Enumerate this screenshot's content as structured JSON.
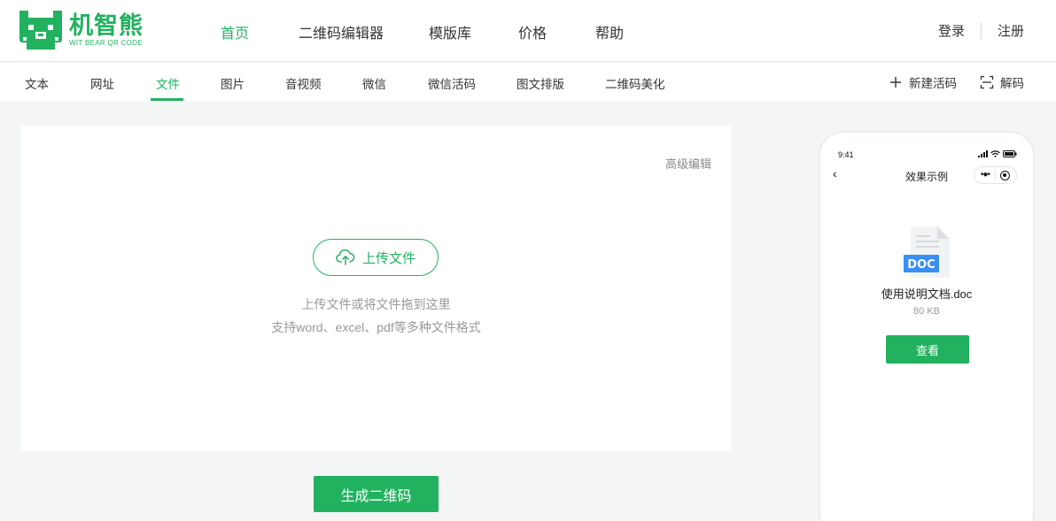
{
  "brand": {
    "name_cn": "机智熊",
    "name_en": "WIT BEAR QR CODE",
    "color": "#22b25f"
  },
  "main_nav": [
    {
      "label": "首页",
      "active": true
    },
    {
      "label": "二维码编辑器",
      "active": false
    },
    {
      "label": "模版库",
      "active": false
    },
    {
      "label": "价格",
      "active": false
    },
    {
      "label": "帮助",
      "active": false
    }
  ],
  "auth": {
    "login": "登录",
    "register": "注册"
  },
  "sub_nav": [
    {
      "label": "文本",
      "active": false
    },
    {
      "label": "网址",
      "active": false
    },
    {
      "label": "文件",
      "active": true
    },
    {
      "label": "图片",
      "active": false
    },
    {
      "label": "音视频",
      "active": false
    },
    {
      "label": "微信",
      "active": false
    },
    {
      "label": "微信活码",
      "active": false
    },
    {
      "label": "图文排版",
      "active": false
    },
    {
      "label": "二维码美化",
      "active": false
    }
  ],
  "sub_actions": {
    "new_live_code": {
      "label": "新建活码",
      "icon": "plus-icon"
    },
    "decode": {
      "label": "解码",
      "icon": "scan-icon"
    }
  },
  "editor": {
    "advanced_edit": "高级编辑",
    "upload_button": "上传文件",
    "upload_icon": "cloud-upload-icon",
    "hint_line1": "上传文件或将文件拖到这里",
    "hint_line2": "支持word、excel、pdf等多种文件格式"
  },
  "generate_button": "生成二维码",
  "preview": {
    "time": "9:41",
    "title": "效果示例",
    "back_icon": "chevron-left-icon",
    "doc_badge": "DOC",
    "file_name": "使用说明文档.doc",
    "file_size": "80 KB",
    "view_button": "查看"
  }
}
